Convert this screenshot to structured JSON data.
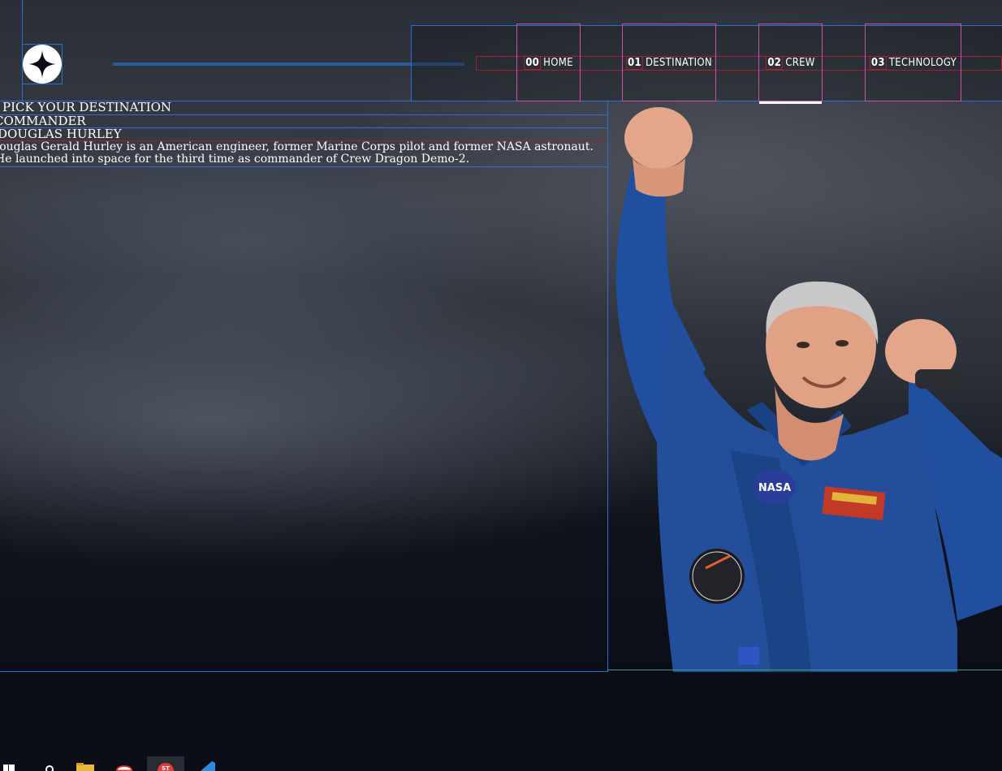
{
  "nav": {
    "items": [
      {
        "num": "00",
        "label": "HOME"
      },
      {
        "num": "01",
        "label": "DESTINATION"
      },
      {
        "num": "02",
        "label": "CREW"
      },
      {
        "num": "03",
        "label": "TECHNOLOGY"
      }
    ],
    "active": "CREW"
  },
  "content": {
    "subheading": "PICK YOUR DESTINATION",
    "role": "COMMANDER",
    "name": "DOUGLAS HURLEY",
    "bio": "Douglas Gerald Hurley is an American engineer, former Marine Corps pilot and former NASA astronaut. He launched into space for the third time as commander of Crew Dragon Demo-2."
  },
  "image": {
    "subject": "crew-member-photo",
    "patch_text": "NASA"
  },
  "colors": {
    "background": "#0b0d17",
    "outline": "#2a6fd6",
    "nav_outline": "#d04fa8",
    "accent_red": "#a0222f",
    "suit_blue": "#1f4f9e"
  },
  "taskbar": {
    "icons": [
      "start-icon",
      "search-icon",
      "file-explorer-icon",
      "browser-icon",
      "app-icon",
      "vscode-icon"
    ]
  }
}
